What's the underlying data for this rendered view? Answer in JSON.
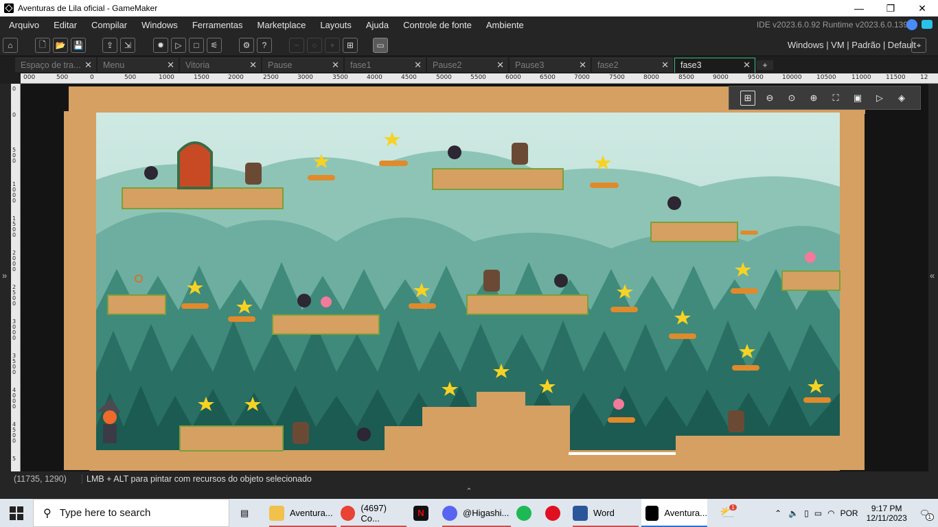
{
  "window": {
    "title": "Aventuras de Lila oficial - GameMaker",
    "controls": [
      "—",
      "❐",
      "✕"
    ]
  },
  "menu": {
    "items": [
      "Arquivo",
      "Editar",
      "Compilar",
      "Windows",
      "Ferramentas",
      "Marketplace",
      "Layouts",
      "Ajuda",
      "Controle de fonte",
      "Ambiente"
    ],
    "version": "IDE v2023.6.0.92  Runtime v2023.6.0.139"
  },
  "toolbar": {
    "target": "Windows | VM | Padrão | Default"
  },
  "tabs": {
    "items": [
      "Espaço de tra...",
      "Menu",
      "Vitoria",
      "Pause",
      "fase1",
      "Pause2",
      "Pause3",
      "fase2",
      "fase3"
    ],
    "active": "fase3",
    "close": "✕",
    "add": "+"
  },
  "ruler": {
    "top": [
      "000",
      "500",
      "0",
      "500",
      "1000",
      "1500",
      "2000",
      "2500",
      "3000",
      "3500",
      "4000",
      "4500",
      "5000",
      "5500",
      "6000",
      "6500",
      "7000",
      "7500",
      "8000",
      "8500",
      "9000",
      "9500",
      "10000",
      "10500",
      "11000",
      "11500",
      "12"
    ],
    "left": [
      "0",
      "0",
      "500",
      "1000",
      "1500",
      "2000",
      "2500",
      "3000",
      "3500",
      "4000",
      "4500",
      "5"
    ]
  },
  "side": {
    "left_arrow": "»",
    "right_arrow": "«"
  },
  "status": {
    "coords": "(11735, 1290)",
    "hint": "LMB + ALT para pintar com recursos do objeto selecionado"
  },
  "dock": {
    "toggle": "⌃"
  },
  "taskbar": {
    "search_placeholder": "Type here to search",
    "apps": [
      "Aventura...",
      "(4697) Co...",
      "@Higashi...",
      "Word",
      "Aventura..."
    ],
    "lang": "POR",
    "time": "9:17 PM",
    "date": "12/11/2023",
    "notif_count": "1",
    "weather_badge": "1"
  },
  "colors": {
    "accent": "#35c07d",
    "ide_bg": "#252526",
    "room_border": "#d5a062",
    "sky": "#bfe3dc"
  }
}
